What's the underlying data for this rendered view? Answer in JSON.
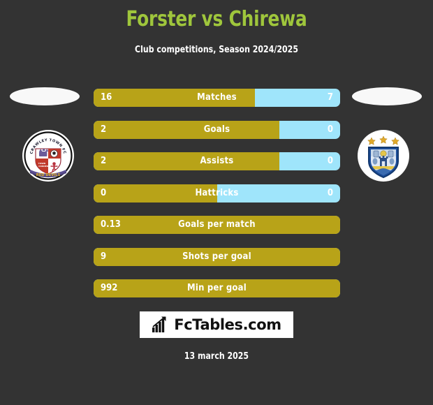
{
  "header": {
    "title": "Forster vs Chirewa",
    "subtitle": "Club competitions, Season 2024/2025",
    "title_color": "#9fc63c",
    "subtitle_color": "#ffffff"
  },
  "colors": {
    "background": "#333333",
    "home_bar": "#b8a318",
    "away_bar": "#9fe5fb",
    "value_text": "#ffffff"
  },
  "teams": {
    "home": {
      "crest_name": "crawley-town-fc-crest",
      "crest_title": "CRAWLEY TOWN FC",
      "crest_motto": "RED DEVILS"
    },
    "away": {
      "crest_name": "huddersfield-town-crest",
      "stars": 3
    }
  },
  "chart_data": {
    "type": "bar",
    "title": "Forster vs Chirewa",
    "subtitle": "Club competitions, Season 2024/2025",
    "orientation": "horizontal-diverging",
    "categories": [
      "Matches",
      "Goals",
      "Assists",
      "Hattricks",
      "Goals per match",
      "Shots per goal",
      "Min per goal"
    ],
    "series": [
      {
        "name": "Forster",
        "side": "left",
        "color": "#b8a318",
        "values": [
          "16",
          "2",
          "2",
          "0",
          "0.13",
          "9",
          "992"
        ]
      },
      {
        "name": "Chirewa",
        "side": "right",
        "color": "#9fe5fb",
        "values": [
          "7",
          "0",
          "0",
          "0",
          "",
          "",
          ""
        ]
      }
    ],
    "rows": [
      {
        "label": "Matches",
        "left": "16",
        "right": "7",
        "fill_pct": 65.5,
        "has_right": true
      },
      {
        "label": "Goals",
        "left": "2",
        "right": "0",
        "fill_pct": 75.4,
        "has_right": true
      },
      {
        "label": "Assists",
        "left": "2",
        "right": "0",
        "fill_pct": 75.4,
        "has_right": true
      },
      {
        "label": "Hattricks",
        "left": "0",
        "right": "0",
        "fill_pct": 50.0,
        "has_right": true
      },
      {
        "label": "Goals per match",
        "left": "0.13",
        "right": "",
        "fill_pct": 100,
        "has_right": false
      },
      {
        "label": "Shots per goal",
        "left": "9",
        "right": "",
        "fill_pct": 100,
        "has_right": false
      },
      {
        "label": "Min per goal",
        "left": "992",
        "right": "",
        "fill_pct": 100,
        "has_right": false
      }
    ]
  },
  "footer": {
    "logo_text": "FcTables.com",
    "logo_icon": "bar-chart-icon",
    "date": "13 march 2025"
  }
}
